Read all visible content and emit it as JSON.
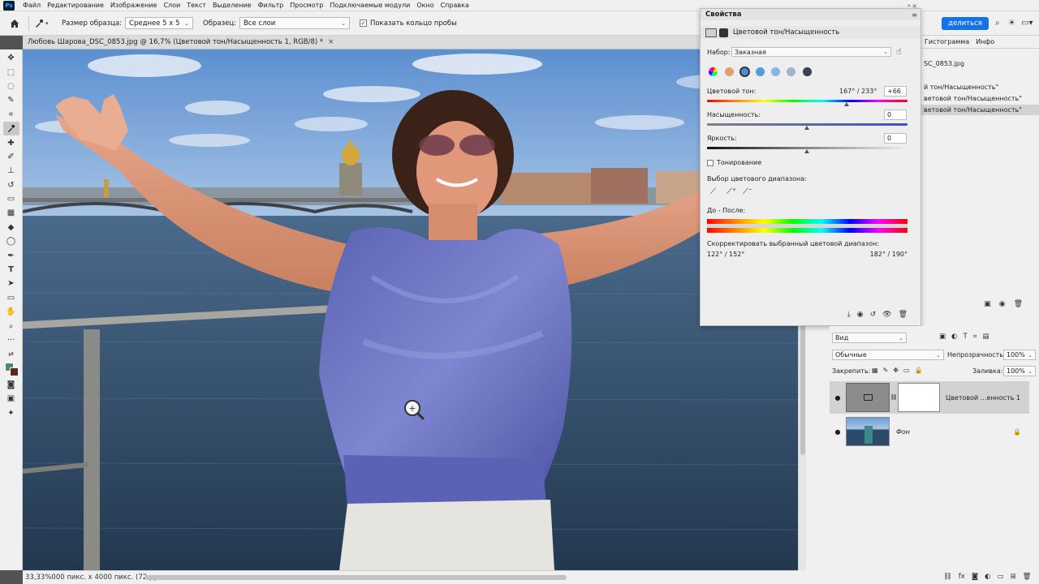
{
  "menu": {
    "logo": "Ps",
    "items": [
      "Файл",
      "Редактирование",
      "Изображение",
      "Слои",
      "Текст",
      "Выделение",
      "Фильтр",
      "Просмотр",
      "Подключаемые модули",
      "Окно",
      "Справка"
    ]
  },
  "options_bar": {
    "sample_size_label": "Размер образца:",
    "sample_size_value": "Среднее 5 x 5",
    "sample_label": "Образец:",
    "sample_value": "Все слои",
    "show_ring_label": "Показать кольцо пробы",
    "share_label": "делиться"
  },
  "document": {
    "tab_title": "Любовь Шарова_DSC_0853.jpg @ 16,7% (Цветовой тон/Насыщенность 1, RGB/8) *",
    "zoom": "33,33%",
    "size_info": "000 пикс. x 4000 пикс. (72 pp"
  },
  "properties": {
    "panel_title": "Свойства",
    "adjustment_name": "Цветовой тон/Насыщенность",
    "preset_label": "Набор:",
    "preset_value": "Заказная",
    "hue_label": "Цветовой тон:",
    "hue_range": "167° / 233°",
    "hue_value": "+66",
    "hue_fraction": 0.695,
    "saturation_label": "Насыщенность:",
    "saturation_value": "0",
    "lightness_label": "Яркость:",
    "lightness_value": "0",
    "colorize_label": "Тонирование",
    "range_label": "Выбор цветового диапазона:",
    "before_after_label": "До - После:",
    "correct_label": "Скорректировать выбранный цветовой диапазон:",
    "range_left": "122° / 152°",
    "range_right": "182° / 190°",
    "swatch_colors": [
      "#e04a4a",
      "#e0a070",
      "#4aa0e0",
      "#4a90d9",
      "#8ab4e0",
      "#a0b4cc",
      "#5a6a88",
      "#3a4256"
    ]
  },
  "history": {
    "tabs": [
      "Гистограмма",
      "Инфо"
    ],
    "doc": "SC_0853.jpg",
    "items": [
      "й тон/Насыщенность\"",
      "ветовой тон/Насыщенность\"",
      "ветовой тон/Насыщенность\""
    ]
  },
  "layers": {
    "kind_label": "Вид",
    "blend_mode": "Обычные",
    "opacity_label": "Непрозрачность:",
    "opacity_value": "100%",
    "lock_label": "Закрепить:",
    "fill_label": "Заливка:",
    "fill_value": "100%",
    "items": [
      {
        "name": "Цветовой ...енность 1"
      },
      {
        "name": "Фон"
      }
    ]
  },
  "colors": {
    "sky_top": "#6f9fd6",
    "water": "#33506e",
    "top": "#6f73bf",
    "accent": "#2e7bd8"
  }
}
